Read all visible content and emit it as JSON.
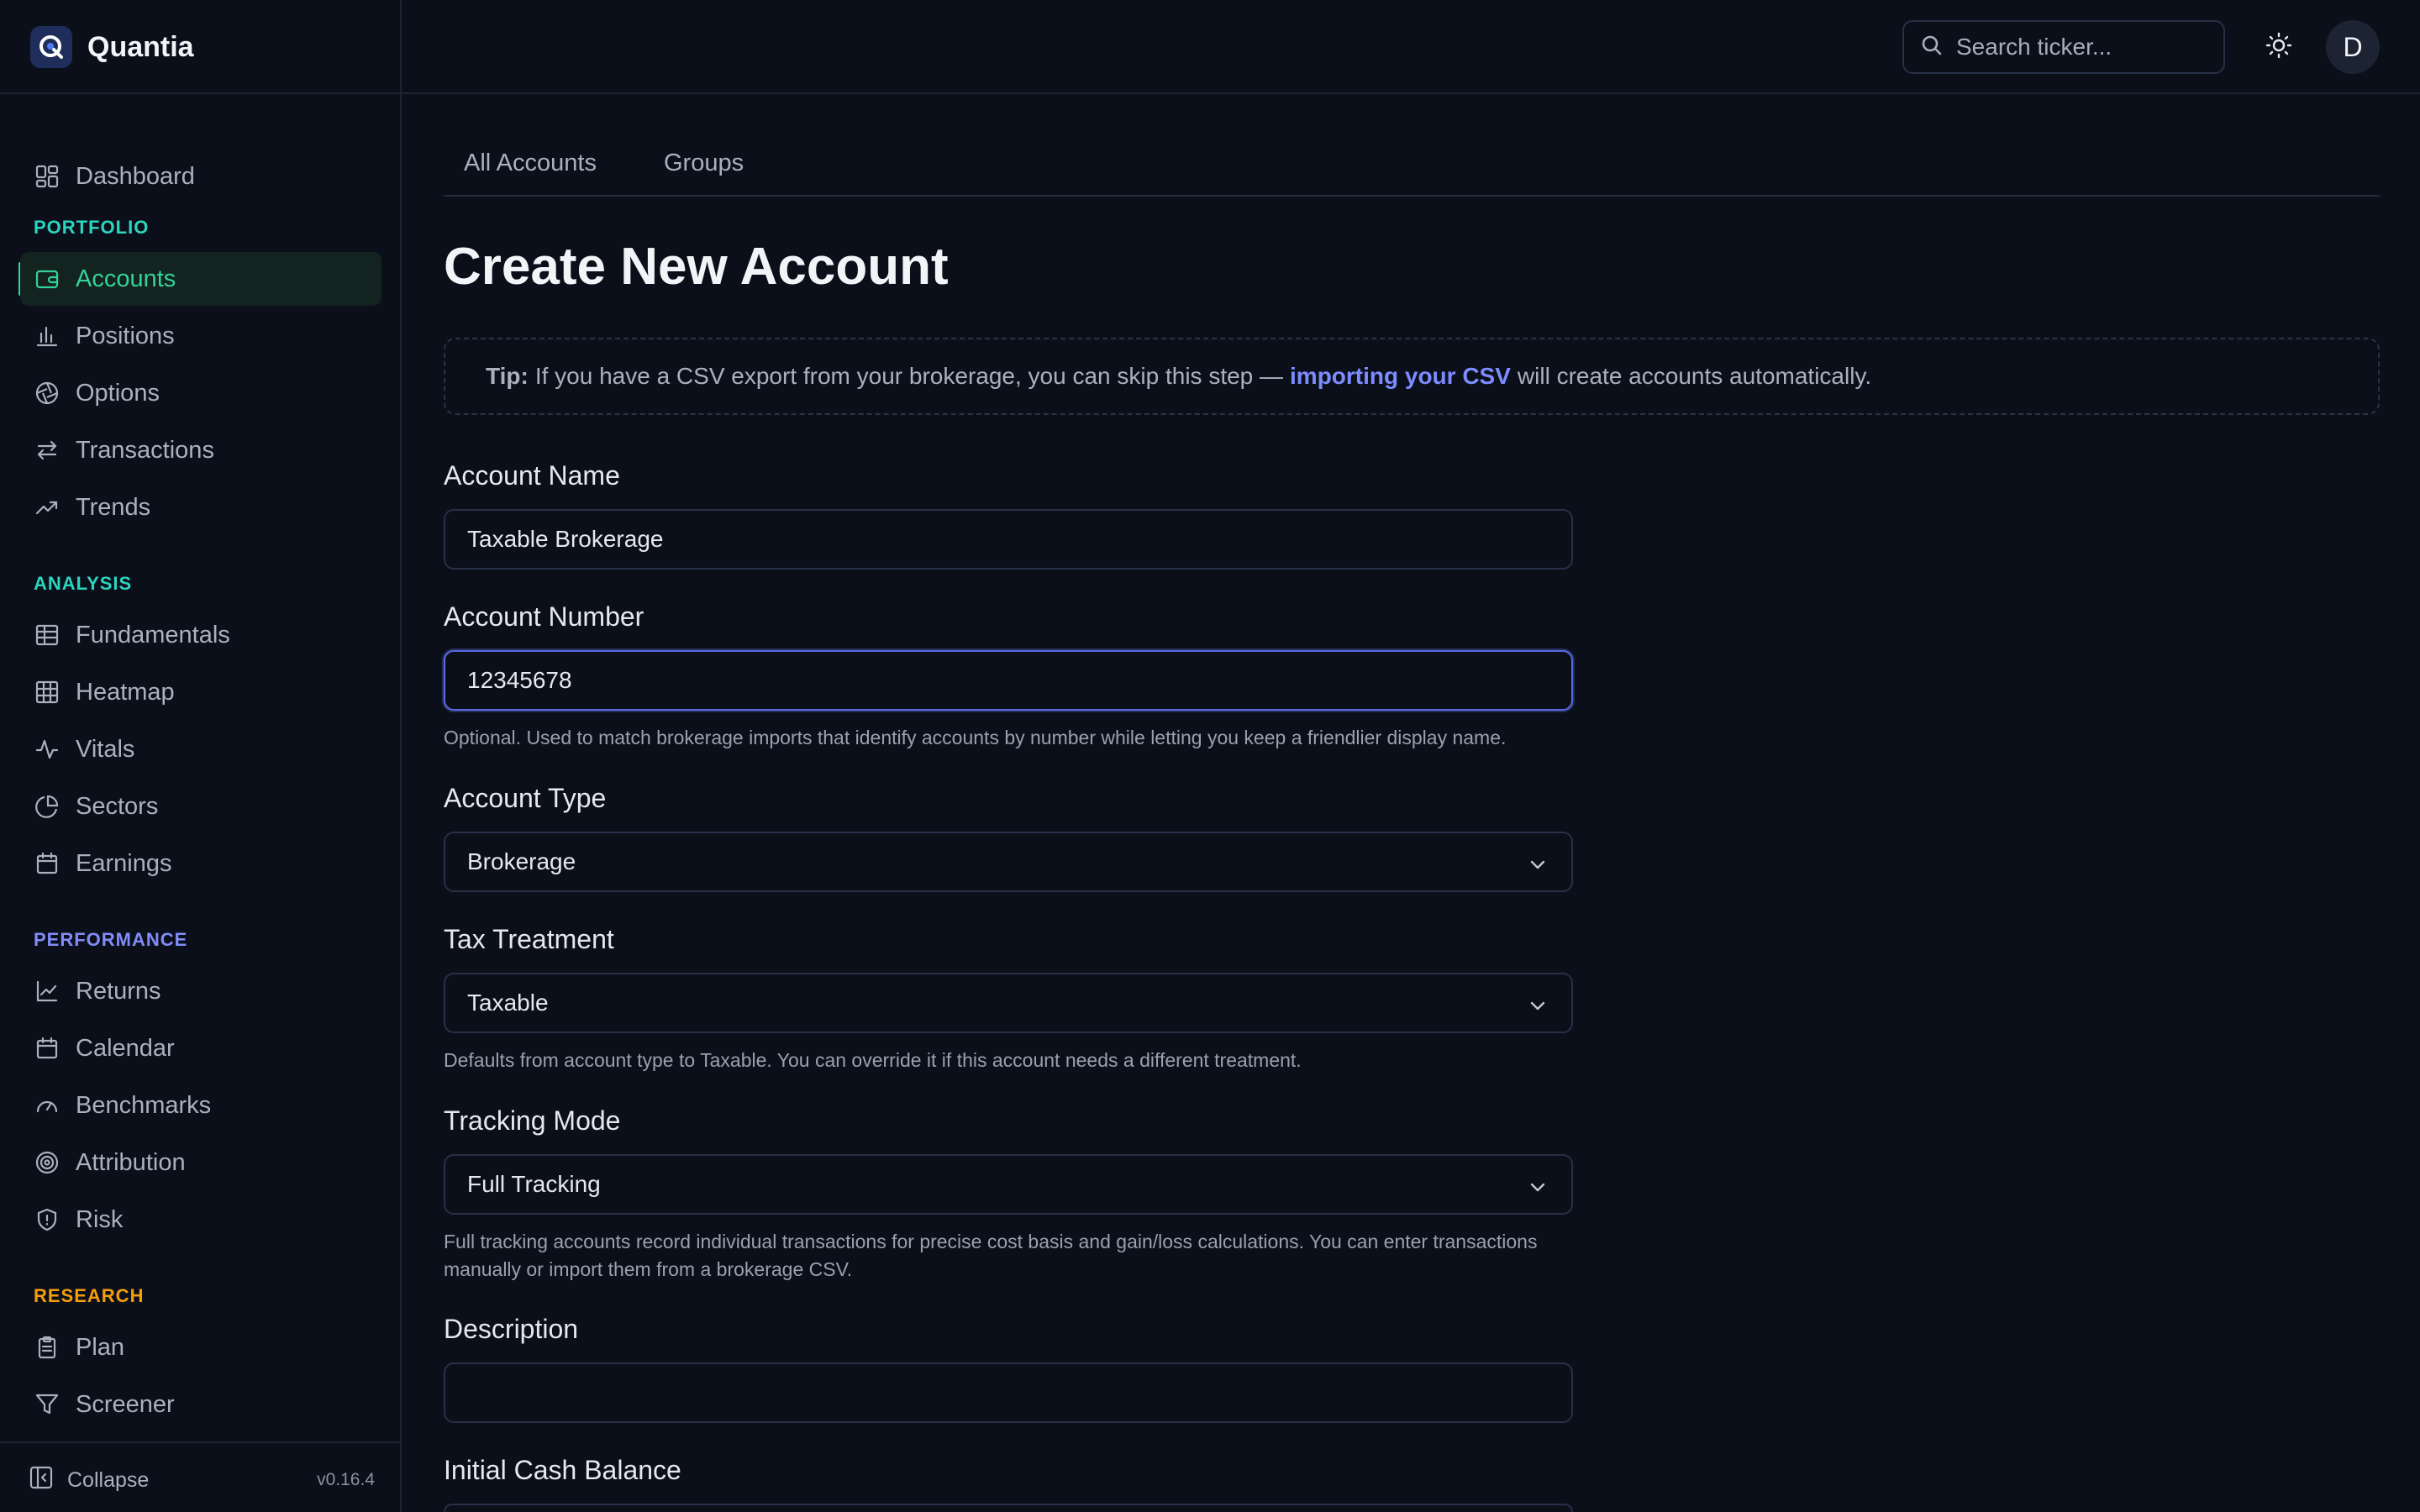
{
  "app": {
    "name": "Quantia",
    "version": "v0.16.4"
  },
  "header": {
    "search_placeholder": "Search ticker...",
    "avatar_initial": "D"
  },
  "sidebar": {
    "dashboard": "Dashboard",
    "sections": {
      "portfolio": "PORTFOLIO",
      "analysis": "ANALYSIS",
      "performance": "PERFORMANCE",
      "research": "RESEARCH"
    },
    "items": {
      "accounts": "Accounts",
      "positions": "Positions",
      "options": "Options",
      "transactions": "Transactions",
      "trends": "Trends",
      "fundamentals": "Fundamentals",
      "heatmap": "Heatmap",
      "vitals": "Vitals",
      "sectors": "Sectors",
      "earnings": "Earnings",
      "returns": "Returns",
      "calendar": "Calendar",
      "benchmarks": "Benchmarks",
      "attribution": "Attribution",
      "risk": "Risk",
      "plan": "Plan",
      "screener": "Screener"
    },
    "collapse": "Collapse"
  },
  "tabs": [
    "All Accounts",
    "Groups"
  ],
  "page": {
    "title": "Create New Account",
    "tip": {
      "label": "Tip:",
      "text_before": "If you have a CSV export from your brokerage, you can skip this step —",
      "link": "importing your CSV",
      "text_after": "will create accounts automatically."
    }
  },
  "form": {
    "account_name": {
      "label": "Account Name",
      "value": "Taxable Brokerage"
    },
    "account_number": {
      "label": "Account Number",
      "value": "12345678",
      "hint": "Optional. Used to match brokerage imports that identify accounts by number while letting you keep a friendlier display name."
    },
    "account_type": {
      "label": "Account Type",
      "value": "Brokerage"
    },
    "tax_treatment": {
      "label": "Tax Treatment",
      "value": "Taxable",
      "hint": "Defaults from account type to Taxable. You can override it if this account needs a different treatment."
    },
    "tracking_mode": {
      "label": "Tracking Mode",
      "value": "Full Tracking",
      "hint": "Full tracking accounts record individual transactions for precise cost basis and gain/loss calculations. You can enter transactions manually or import them from a brokerage CSV."
    },
    "description": {
      "label": "Description",
      "value": ""
    },
    "initial_cash": {
      "label": "Initial Cash Balance"
    }
  },
  "colors": {
    "background": "#0b0f1a",
    "accent_green": "#34d399",
    "accent_indigo": "#7c8cff",
    "portfolio_heading": "#2dd4bf",
    "analysis_heading": "#2dd4bf",
    "performance_heading": "#818cf8",
    "research_heading": "#f59e0b"
  }
}
